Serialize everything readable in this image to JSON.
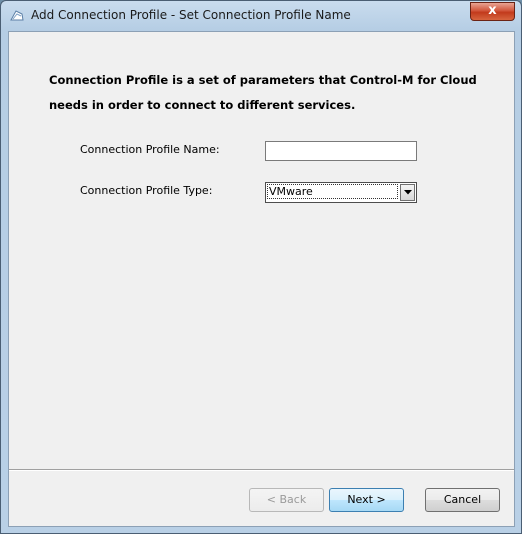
{
  "window": {
    "title": "Add Connection Profile - Set Connection Profile Name",
    "close_glyph": "x"
  },
  "content": {
    "description": "Connection Profile is a set of parameters that Control-M for Cloud needs in order to connect to different services.",
    "name_label": "Connection Profile Name:",
    "name_value": "",
    "type_label": "Connection Profile Type:",
    "type_value": "VMware"
  },
  "buttons": {
    "back": "< Back",
    "next": "Next >",
    "cancel": "Cancel"
  },
  "icons": {
    "title_icon": "wizard-app-icon",
    "dropdown_icon": "chevron-down-icon"
  }
}
